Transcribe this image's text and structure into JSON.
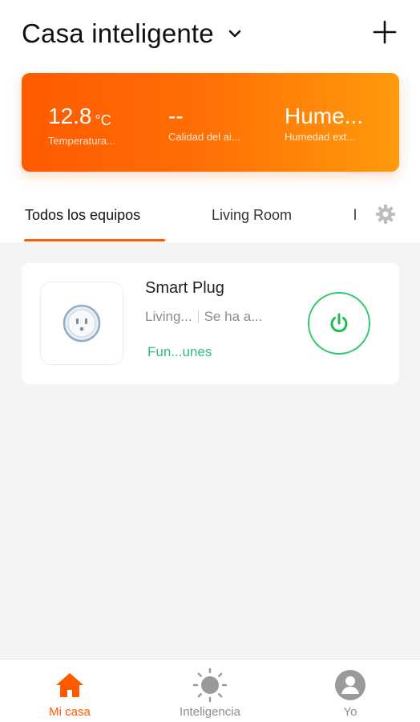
{
  "header": {
    "home_name": "Casa inteligente",
    "dropdown_icon": "chevron-down-icon",
    "add_icon": "plus-icon"
  },
  "weather": {
    "temperature": {
      "value": "12.8",
      "unit": "°C",
      "label": "Temperatura..."
    },
    "air_quality": {
      "value": "--",
      "label": "Calidad del ai..."
    },
    "humidity": {
      "value": "Hume...",
      "label": "Humedad ext..."
    },
    "gradient_start": "#ff5a00",
    "gradient_end": "#ff9a0c"
  },
  "tabs": {
    "items": [
      {
        "label": "Todos los equipos",
        "active": true
      },
      {
        "label": "Living Room",
        "active": false
      },
      {
        "label": "l",
        "active": false
      }
    ],
    "settings_icon": "gear-icon"
  },
  "device": {
    "name": "Smart Plug",
    "room": "Living...",
    "status": "Se ha a...",
    "functions_label": "Fun...unes",
    "icon": "smart-plug-icon",
    "power_icon": "power-icon",
    "power_color": "#30c96a"
  },
  "bottom_nav": {
    "items": [
      {
        "label": "Mi casa",
        "icon": "home-icon",
        "active": true
      },
      {
        "label": "Inteligencia",
        "icon": "sun-icon",
        "active": false
      },
      {
        "label": "Yo",
        "icon": "user-icon",
        "active": false
      }
    ]
  },
  "colors": {
    "accent": "#ff5a00",
    "green": "#2ec07c",
    "background": "#f4f4f4"
  }
}
